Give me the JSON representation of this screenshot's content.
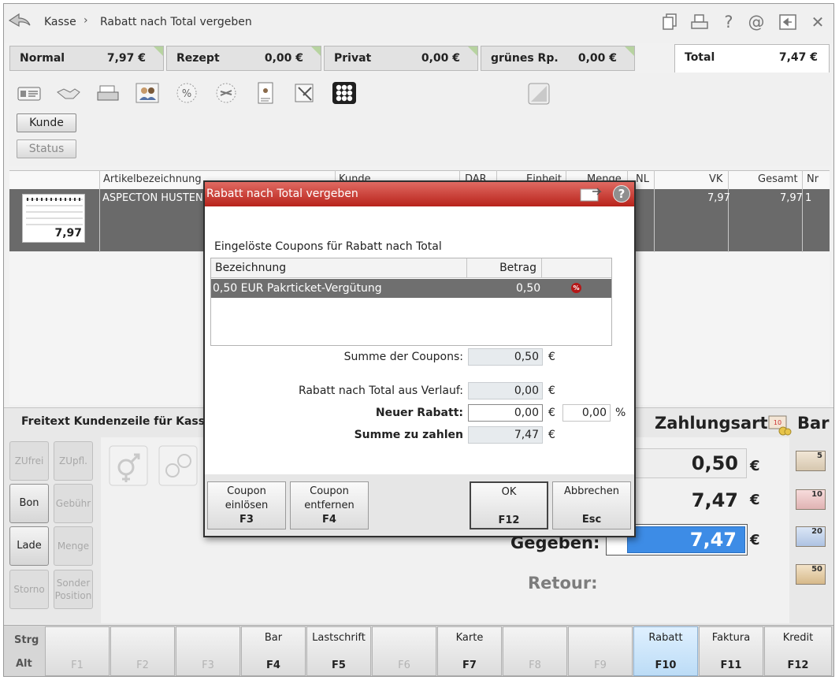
{
  "header": {
    "breadcrumb_root": "Kasse",
    "breadcrumb_sep": "›",
    "page_title": "Rabatt nach Total vergeben",
    "help_glyph": "?",
    "at_glyph": "@",
    "close_glyph": "✕"
  },
  "tabs": [
    {
      "label": "Normal",
      "value": "7,97 €"
    },
    {
      "label": "Rezept",
      "value": "0,00 €"
    },
    {
      "label": "Privat",
      "value": "0,00 €"
    },
    {
      "label": "grünes Rp.",
      "value": "0,00 €"
    },
    {
      "label": "Total",
      "value": "7,47 €"
    }
  ],
  "toolbar": {
    "kunde_label": "Kunde",
    "status_label": "Status"
  },
  "table": {
    "headers": {
      "artikel": "Artikelbezeichnung",
      "kunde": "Kunde",
      "dar": "DAR",
      "einheit": "Einheit",
      "menge": "Menge",
      "nl": "NL",
      "vk": "VK",
      "gesamt": "Gesamt",
      "nr": "Nr"
    },
    "row": {
      "thumb_price": "7,97",
      "artikel": "ASPECTON HUSTEN",
      "vk": "7,97",
      "gesamt": "7,97",
      "nr": "1"
    }
  },
  "lower": {
    "freitext": "Freitext Kundenzeile für Kassenb",
    "zahlungsart_label": "Zahlungsart:",
    "zahlungsart_value": "Bar",
    "amount1": "0,50",
    "amount2": "7,47",
    "gegeben_label": "Gegeben:",
    "gegeben_value": "7,47",
    "retour_label": "Retour:",
    "euro": "€",
    "side_buttons": {
      "zufrei": "ZUfrei",
      "zupfl": "ZUpfl.",
      "bon": "Bon",
      "gebuehr": "Gebühr",
      "lade": "Lade",
      "menge": "Menge",
      "storno": "Storno",
      "sonder_1": "Sonder",
      "sonder_2": "Position"
    },
    "bills": [
      "5",
      "10",
      "20",
      "50"
    ]
  },
  "fkeys": {
    "strg": "Strg",
    "alt": "Alt",
    "keys": [
      {
        "top": "",
        "key": "F1"
      },
      {
        "top": "",
        "key": "F2"
      },
      {
        "top": "",
        "key": "F3"
      },
      {
        "top": "Bar",
        "key": "F4"
      },
      {
        "top": "Lastschrift",
        "key": "F5"
      },
      {
        "top": "",
        "key": "F6"
      },
      {
        "top": "Karte",
        "key": "F7"
      },
      {
        "top": "",
        "key": "F8"
      },
      {
        "top": "",
        "key": "F9"
      },
      {
        "top": "Rabatt",
        "key": "F10"
      },
      {
        "top": "Faktura",
        "key": "F11"
      },
      {
        "top": "Kredit",
        "key": "F12"
      }
    ]
  },
  "dialog": {
    "title": "Rabatt nach Total vergeben",
    "help_glyph": "?",
    "section_title": "Eingelöste Coupons für Rabatt nach Total",
    "col_bezeichnung": "Bezeichnung",
    "col_betrag": "Betrag",
    "coupon": {
      "bezeichnung": "0,50 EUR Pakrticket-Vergütung",
      "betrag": "0,50",
      "badge": "%"
    },
    "summe_coupons_label": "Summe der Coupons:",
    "summe_coupons_value": "0,50",
    "rabatt_verlauf_label": "Rabatt nach Total aus Verlauf:",
    "rabatt_verlauf_value": "0,00",
    "neuer_rabatt_label": "Neuer Rabatt:",
    "neuer_rabatt_value": "0,00",
    "neuer_rabatt_percent": "0,00",
    "percent_sign": "%",
    "summe_zahlen_label": "Summe zu zahlen",
    "summe_zahlen_value": "7,47",
    "euro": "€",
    "buttons": {
      "einloesen_1": "Coupon",
      "einloesen_2": "einlösen",
      "einloesen_key": "F3",
      "entfernen_1": "Coupon",
      "entfernen_2": "entfernen",
      "entfernen_key": "F4",
      "ok": "OK",
      "ok_key": "F12",
      "abbrechen": "Abbrechen",
      "abbrechen_key": "Esc"
    }
  }
}
